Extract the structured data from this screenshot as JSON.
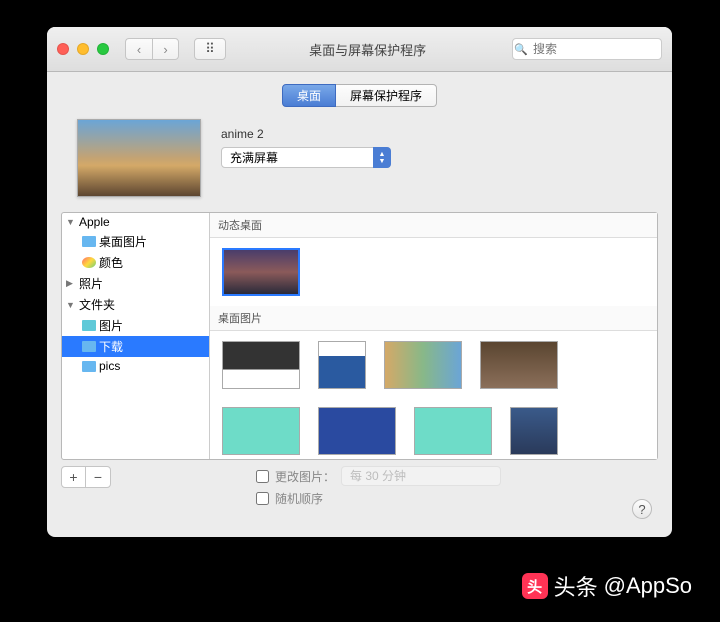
{
  "window": {
    "title": "桌面与屏幕保护程序",
    "search_placeholder": "搜索"
  },
  "tabs": {
    "desktop": "桌面",
    "screensaver": "屏幕保护程序"
  },
  "preview": {
    "name": "anime 2",
    "fill_mode": "充满屏幕"
  },
  "sidebar": {
    "apple": "Apple",
    "desktop_pics": "桌面图片",
    "colors": "颜色",
    "photos": "照片",
    "folders": "文件夹",
    "pictures": "图片",
    "downloads": "下载",
    "pics": "pics"
  },
  "sections": {
    "dynamic": "动态桌面",
    "desktop_pics": "桌面图片"
  },
  "footer": {
    "change_picture": "更改图片：",
    "interval": "每 30 分钟",
    "random": "随机顺序",
    "add": "+",
    "remove": "−",
    "help": "?"
  },
  "watermark": {
    "prefix": "头条",
    "handle": "@AppSo"
  }
}
